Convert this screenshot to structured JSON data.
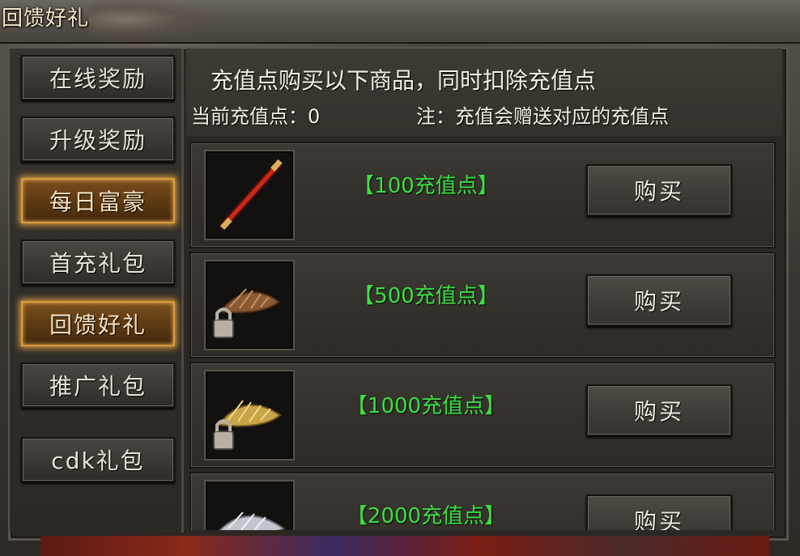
{
  "window": {
    "title": "回馈好礼"
  },
  "sidebar": {
    "items": [
      {
        "label": "在线奖励",
        "active": false
      },
      {
        "label": "升级奖励",
        "active": false
      },
      {
        "label": "每日富豪",
        "active": true
      },
      {
        "label": "首充礼包",
        "active": false
      },
      {
        "label": "回馈好礼",
        "active": true
      },
      {
        "label": "推广礼包",
        "active": false
      },
      {
        "label": "cdk礼包",
        "active": false
      }
    ]
  },
  "header": {
    "line1": "充值点购买以下商品，同时扣除充值点",
    "current_points": "当前充值点：0",
    "note": "注：充值会赠送对应的充值点"
  },
  "shop": {
    "items": [
      {
        "price": "【100充值点】",
        "buy_label": "购买",
        "icon": "staff-icon",
        "locked": false
      },
      {
        "price": "【500充值点】",
        "buy_label": "购买",
        "icon": "straw-hat-icon",
        "locked": true
      },
      {
        "price": "【1000充值点】",
        "buy_label": "购买",
        "icon": "gold-hat-icon",
        "locked": true
      },
      {
        "price": "【2000充值点】",
        "buy_label": "购买",
        "icon": "silver-hat-icon",
        "locked": false
      }
    ]
  },
  "colors": {
    "price_text": "#3be040",
    "active_border": "#d89a3a",
    "panel_bg": "#2b2824"
  }
}
